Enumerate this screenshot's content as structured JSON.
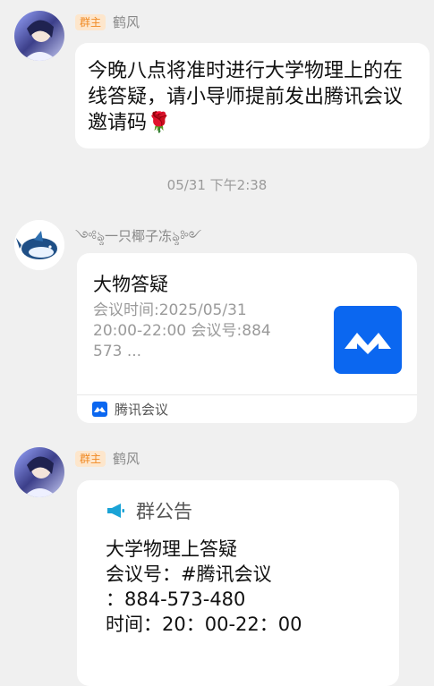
{
  "messages": [
    {
      "sender_badge": "群主",
      "sender_name": "鹤风",
      "text": "今晚八点将准时进行大学物理上的在线答疑，请小导师提前发出腾讯会议邀请码🌹"
    }
  ],
  "timestamp": "05/31 下午2:38",
  "card_message": {
    "sender_name": "༺ৡ一只椰子冻ৡ༻",
    "card_title": "大物答疑",
    "card_desc": "会议时间:2025/05/31 20:00-22:00 会议号:884 573 ...",
    "source_app": "腾讯会议"
  },
  "notice_message": {
    "sender_badge": "群主",
    "sender_name": "鹤风",
    "notice_label": "群公告",
    "notice_body": "大学物理上答疑\n会议号：#腾讯会议\n：884-573-480\n时间：20：00-22：00"
  },
  "colors": {
    "background": "#f0f0f0",
    "owner_badge_bg": "#fde6cc",
    "owner_badge_text": "#f08a24",
    "tencent_meeting_blue": "#0b67f0",
    "notice_icon": "#1aa3d6"
  },
  "icons": [
    "avatar-heguang",
    "avatar-whale",
    "tencent-meeting-icon",
    "megaphone-icon"
  ]
}
